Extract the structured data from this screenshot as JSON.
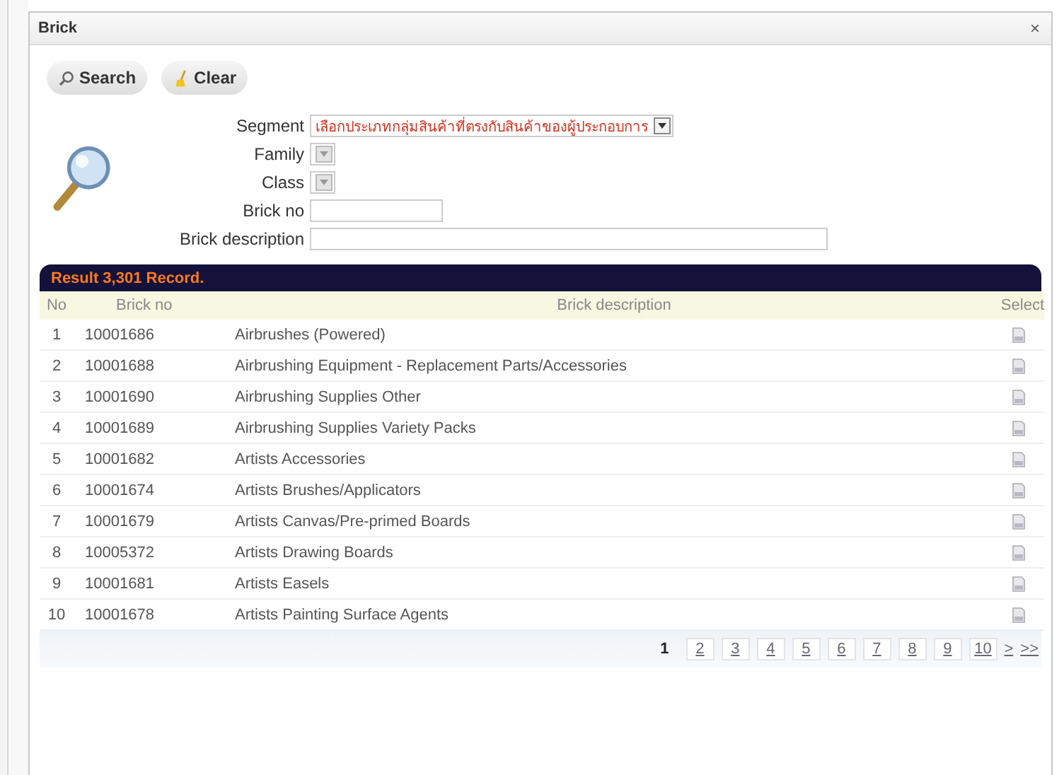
{
  "window": {
    "title": "Brick",
    "close": "×"
  },
  "toolbar": [
    {
      "kind": "search",
      "label": "Search"
    },
    {
      "kind": "clear",
      "label": "Clear"
    }
  ],
  "form": {
    "fields": [
      {
        "kind": "select",
        "label": "Segment",
        "value": "เลือกประเภทกลุ่มสินค้าที่ตรงกับสินค้าของผู้ประกอบการ",
        "disabled": false
      },
      {
        "kind": "select",
        "label": "Family",
        "disabled": true
      },
      {
        "kind": "select",
        "label": "Class",
        "disabled": true
      },
      {
        "kind": "text",
        "label": "Brick no"
      },
      {
        "kind": "textwide",
        "label": "Brick description"
      }
    ]
  },
  "result": {
    "title": "Result 3,301 Record."
  },
  "table": {
    "columns": [
      "No",
      "Brick no",
      "Brick description",
      "Select"
    ],
    "rows": [
      {
        "no": "1",
        "brick_no": "10001686",
        "description": "Airbrushes (Powered)"
      },
      {
        "no": "2",
        "brick_no": "10001688",
        "description": "Airbrushing Equipment - Replacement Parts/Accessories"
      },
      {
        "no": "3",
        "brick_no": "10001690",
        "description": "Airbrushing Supplies Other"
      },
      {
        "no": "4",
        "brick_no": "10001689",
        "description": "Airbrushing Supplies Variety Packs"
      },
      {
        "no": "5",
        "brick_no": "10001682",
        "description": "Artists Accessories"
      },
      {
        "no": "6",
        "brick_no": "10001674",
        "description": "Artists Brushes/Applicators"
      },
      {
        "no": "7",
        "brick_no": "10001679",
        "description": "Artists Canvas/Pre-primed Boards"
      },
      {
        "no": "8",
        "brick_no": "10005372",
        "description": "Artists Drawing Boards"
      },
      {
        "no": "9",
        "brick_no": "10001681",
        "description": "Artists Easels"
      },
      {
        "no": "10",
        "brick_no": "10001678",
        "description": "Artists Painting Surface Agents"
      }
    ]
  },
  "pager": {
    "pages": [
      {
        "label": "1",
        "selected": true
      },
      {
        "label": "2",
        "selected": false
      },
      {
        "label": "3",
        "selected": false
      },
      {
        "label": "4",
        "selected": false
      },
      {
        "label": "5",
        "selected": false
      },
      {
        "label": "6",
        "selected": false
      },
      {
        "label": "7",
        "selected": false
      },
      {
        "label": "8",
        "selected": false
      },
      {
        "label": "9",
        "selected": false
      },
      {
        "label": "10",
        "selected": false
      }
    ],
    "next": ">",
    "last": ">>"
  }
}
